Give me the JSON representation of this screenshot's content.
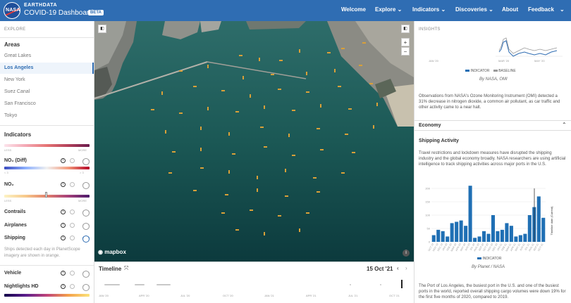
{
  "header": {
    "brand_top": "EARTHDATA",
    "brand_main": "COVID-19 Dashboard",
    "badge": "BETA",
    "logo_text": "NASA",
    "nav": [
      "Welcome",
      "Explore",
      "Indicators",
      "Discoveries",
      "About",
      "Feedback"
    ]
  },
  "left": {
    "explore_label": "EXPLORE",
    "areas_title": "Areas",
    "areas": [
      "Great Lakes",
      "Los Angeles",
      "New York",
      "Suez Canal",
      "San Francisco",
      "Tokyo"
    ],
    "active_area": "Los Angeles",
    "indicators_title": "Indicators",
    "less": "LESS",
    "more": "MORE",
    "no2_diff_label": "NO₂ (Diff)",
    "no2_diff_min": "< 3",
    "no2_diff_max": "> 3",
    "no2_label": "NO₂",
    "contrails_label": "Contrails",
    "airplanes_label": "Airplanes",
    "shipping_label": "Shipping",
    "shipping_desc": "Ships detected each day in PlanetScope imagery are shown in orange.",
    "vehicle_label": "Vehicle",
    "nightlights_label": "Nightlights HD"
  },
  "map": {
    "mapbox_label": "mapbox",
    "zoom_in": "+",
    "zoom_out": "−",
    "compare_icon": "compare-icon",
    "info_icon": "info-icon"
  },
  "timeline": {
    "title": "Timeline",
    "date": "15 Oct '21",
    "ticks": [
      "JAN '20",
      "APR '20",
      "JUL '20",
      "OCT '20",
      "JAN '21",
      "APR '21",
      "JUL '21",
      "OCT '21"
    ]
  },
  "right": {
    "insights_label": "INSIGHTS",
    "top_chart_ticks": [
      "JAN '20",
      "MAR '20",
      "MAY '20"
    ],
    "legend_indicator": "INDICATOR",
    "legend_baseline": "BASELINE",
    "top_caption": "By NASA, OMI",
    "omi_text": "Observations from NASA's Ozone Monitoring Instrument (OMI) detected a 31% decrease in nitrogen dioxide, a common air pollutant, as car traffic and other activity came to a near halt.",
    "economy_label": "Economy",
    "shipping_activity_title": "Shipping Activity",
    "shipping_text": "Travel restrictions and lockdown measures have disrupted the shipping industry and the global economy broadly. NASA researchers are using artificial intelligence to track shipping activities across major ports in the U.S.",
    "chart_legend": "INDICATOR",
    "chart_caption": "By Planet / NASA",
    "chart_annotation": "Timeline date (Current)",
    "bottom_text": "The Port of Los Angeles, the busiest port in the U.S. and one of the busiest ports in the world, reported overall shipping cargo volumes were down 19% for the first five months of 2020, compared to 2019."
  },
  "chart_data": {
    "type": "bar",
    "title": "Shipping Activity",
    "categories": [
      "Oct 19",
      "Nov 19",
      "Dec 19",
      "Jan 20",
      "Feb 20",
      "Mar 20",
      "Apr 20",
      "May 20",
      "Jun 20",
      "Jul 20",
      "Aug 20",
      "Sep 20",
      "Oct 20",
      "Nov 20",
      "Dec 20",
      "Jan 21",
      "Feb 21",
      "Mar 21",
      "Apr 21",
      "May 21",
      "Jun 21",
      "Jul 21",
      "Aug 21",
      "Sep 21",
      "Oct 21"
    ],
    "values": [
      25,
      45,
      40,
      20,
      70,
      75,
      80,
      60,
      210,
      15,
      20,
      40,
      30,
      100,
      40,
      45,
      70,
      60,
      20,
      25,
      30,
      100,
      130,
      170,
      90
    ],
    "ylim": [
      0,
      200
    ],
    "yticks": [
      0,
      50,
      100,
      150,
      200
    ],
    "bar_color": "#1f6fb4"
  }
}
